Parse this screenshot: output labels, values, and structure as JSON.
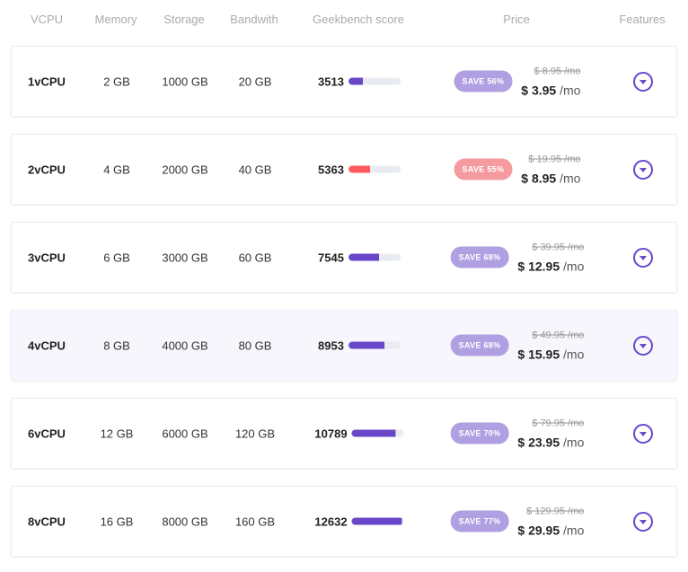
{
  "headers": [
    "VCPU",
    "Memory",
    "Storage",
    "Bandwith",
    "Geekbench score",
    "Price",
    "Features"
  ],
  "colors": {
    "accent": "#6a47c9",
    "badge": "#b0a0e2",
    "hot": "#ff5a5f",
    "hot_badge": "#f59ba0",
    "bar_track": "#e8ebef"
  },
  "plans": [
    {
      "vcpu": "1vCPU",
      "memory": "2 GB",
      "storage": "1000 GB",
      "bandwidth": "20 GB",
      "score": "3513",
      "score_fraction": 0.27,
      "save": "SAVE 56%",
      "old_price": "$ 8.95 /mo",
      "price": "$ 3.95",
      "per": "/mo",
      "hot": false,
      "highlight": false,
      "features_icon": "chevron-down-circle-icon"
    },
    {
      "vcpu": "2vCPU",
      "memory": "4 GB",
      "storage": "2000 GB",
      "bandwidth": "40 GB",
      "score": "5363",
      "score_fraction": 0.41,
      "save": "SAVE 55%",
      "old_price": "$ 19.95 /mo",
      "price": "$ 8.95",
      "per": "/mo",
      "hot": true,
      "highlight": false,
      "features_icon": "chevron-down-circle-icon"
    },
    {
      "vcpu": "3vCPU",
      "memory": "6 GB",
      "storage": "3000 GB",
      "bandwidth": "60 GB",
      "score": "7545",
      "score_fraction": 0.58,
      "save": "SAVE 68%",
      "old_price": "$ 39.95 /mo",
      "price": "$ 12.95",
      "per": "/mo",
      "hot": false,
      "highlight": false,
      "features_icon": "chevron-down-circle-icon"
    },
    {
      "vcpu": "4vCPU",
      "memory": "8 GB",
      "storage": "4000 GB",
      "bandwidth": "80 GB",
      "score": "8953",
      "score_fraction": 0.69,
      "save": "SAVE 68%",
      "old_price": "$ 49.95 /mo",
      "price": "$ 15.95",
      "per": "/mo",
      "hot": false,
      "highlight": true,
      "features_icon": "chevron-down-circle-icon"
    },
    {
      "vcpu": "6vCPU",
      "memory": "12 GB",
      "storage": "6000 GB",
      "bandwidth": "120 GB",
      "score": "10789",
      "score_fraction": 0.84,
      "save": "SAVE 70%",
      "old_price": "$ 79.95 /mo",
      "price": "$ 23.95",
      "per": "/mo",
      "hot": false,
      "highlight": false,
      "features_icon": "chevron-down-circle-icon"
    },
    {
      "vcpu": "8vCPU",
      "memory": "16 GB",
      "storage": "8000 GB",
      "bandwidth": "160 GB",
      "score": "12632",
      "score_fraction": 0.97,
      "save": "SAVE 77%",
      "old_price": "$ 129.95 /mo",
      "price": "$ 29.95",
      "per": "/mo",
      "hot": false,
      "highlight": false,
      "features_icon": "chevron-down-circle-icon"
    }
  ]
}
